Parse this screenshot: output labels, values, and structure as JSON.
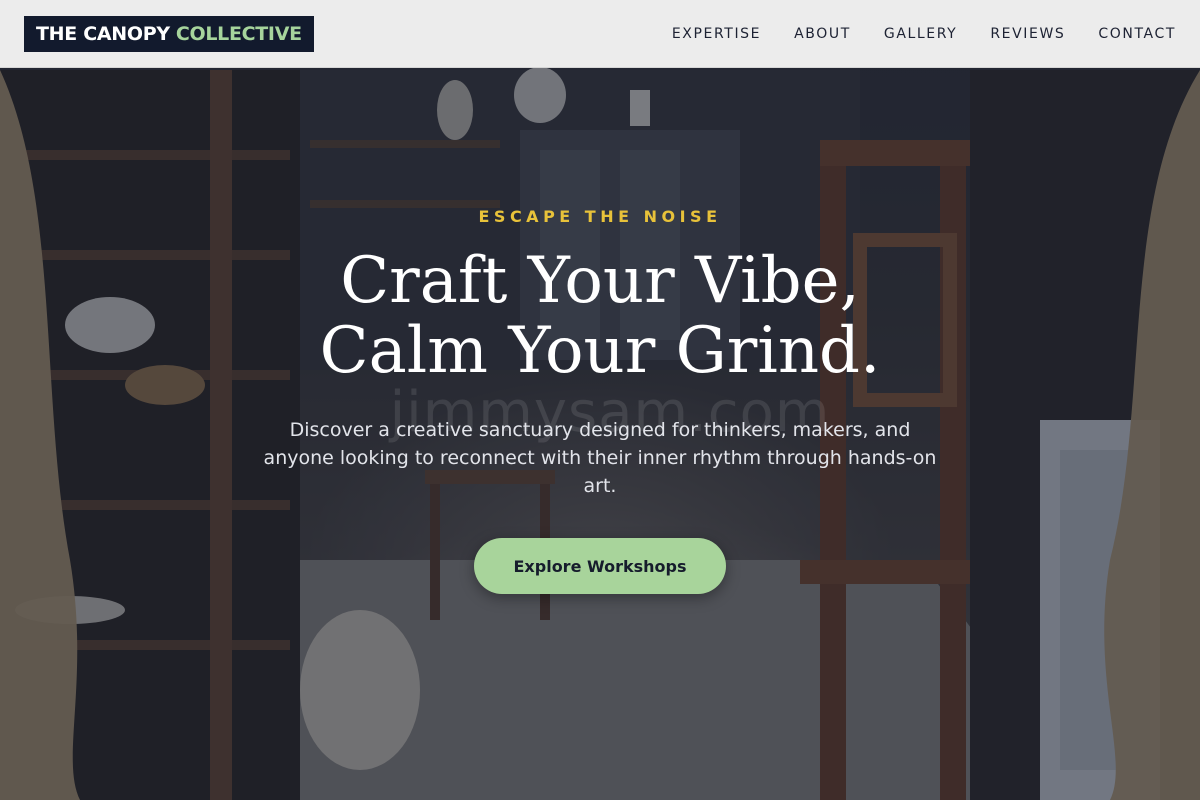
{
  "brand": {
    "name_part1": "THE CANOPY",
    "name_part2": "COLLECTIVE",
    "colors": {
      "logo_bg": "#121a2d",
      "logo_accent": "#a6d49c"
    }
  },
  "nav": {
    "items": [
      {
        "label": "EXPERTISE"
      },
      {
        "label": "ABOUT"
      },
      {
        "label": "GALLERY"
      },
      {
        "label": "REVIEWS"
      },
      {
        "label": "CONTACT"
      }
    ]
  },
  "hero": {
    "eyebrow": "ESCAPE THE NOISE",
    "headline_line1": "Craft Your Vibe,",
    "headline_line2": "Calm Your Grind.",
    "description": "Discover a creative sanctuary designed for thinkers, makers, and anyone looking to reconnect with their inner rhythm through hands-on art.",
    "cta_label": "Explore Workshops",
    "watermark_text": "jimmysam.com",
    "colors": {
      "eyebrow": "#e8c23a",
      "cta_bg": "#a8d49b",
      "overlay": "#161a2c"
    }
  }
}
